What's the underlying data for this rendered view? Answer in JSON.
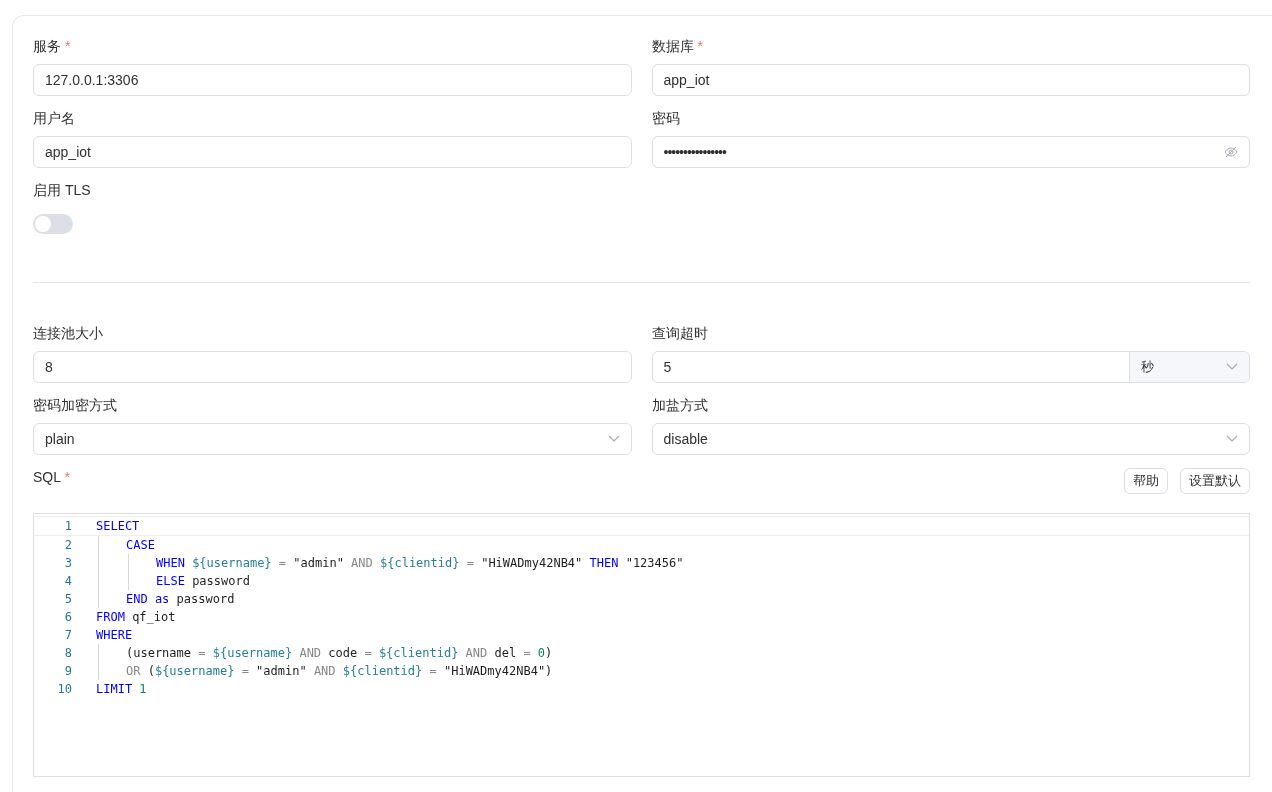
{
  "connection_fields": [
    {
      "kind": "text",
      "label": "服务",
      "required_mark": "*",
      "value": "127.0.0.1:3306"
    },
    {
      "kind": "text",
      "label": "数据库",
      "required_mark": "*",
      "value": "app_iot"
    },
    {
      "kind": "text",
      "label": "用户名",
      "value": "app_iot"
    },
    {
      "kind": "password",
      "label": "密码",
      "value": "••••••••••••••••"
    },
    {
      "kind": "toggle",
      "label": "启用 TLS",
      "on": false
    }
  ],
  "options_fields": [
    {
      "kind": "text",
      "label": "连接池大小",
      "value": "8"
    },
    {
      "kind": "unit",
      "label": "查询超时",
      "value": "5",
      "unit": "秒"
    },
    {
      "kind": "select",
      "label": "密码加密方式",
      "value": "plain"
    },
    {
      "kind": "select",
      "label": "加盐方式",
      "value": "disable"
    }
  ],
  "sql": {
    "label": "SQL",
    "required_mark": "*",
    "buttons": [
      "帮助",
      "设置默认"
    ],
    "lines": [
      {
        "number": "1",
        "tokens": [
          {
            "kind": "keyword",
            "text": "SELECT"
          }
        ],
        "children": [
          {
            "number": "2",
            "tokens": [
              {
                "kind": "keyword",
                "text": "CASE"
              }
            ],
            "children": [
              {
                "number": "3",
                "tokens": [
                  {
                    "kind": "keyword",
                    "text": "WHEN "
                  },
                  {
                    "kind": "var",
                    "text": "${username}"
                  },
                  {
                    "kind": "op",
                    "text": " = "
                  },
                  {
                    "kind": "plain",
                    "text": "\"admin\" "
                  },
                  {
                    "kind": "op",
                    "text": "AND "
                  },
                  {
                    "kind": "var",
                    "text": "${clientid}"
                  },
                  {
                    "kind": "op",
                    "text": " = "
                  },
                  {
                    "kind": "plain",
                    "text": "\"HiWADmy42NB4\" "
                  },
                  {
                    "kind": "keyword",
                    "text": "THEN "
                  },
                  {
                    "kind": "plain",
                    "text": "\"123456\""
                  }
                ]
              },
              {
                "number": "4",
                "tokens": [
                  {
                    "kind": "keyword",
                    "text": "ELSE "
                  },
                  {
                    "kind": "plain",
                    "text": "password"
                  }
                ]
              }
            ]
          },
          {
            "number": "5",
            "tokens": [
              {
                "kind": "keyword",
                "text": "END as "
              },
              {
                "kind": "plain",
                "text": "password"
              }
            ]
          }
        ]
      },
      {
        "number": "6",
        "tokens": [
          {
            "kind": "keyword",
            "text": "FROM "
          },
          {
            "kind": "plain",
            "text": "qf_iot"
          }
        ]
      },
      {
        "number": "7",
        "tokens": [
          {
            "kind": "keyword",
            "text": "WHERE"
          }
        ],
        "children": [
          {
            "number": "8",
            "tokens": [
              {
                "kind": "plain",
                "text": "(username "
              },
              {
                "kind": "op",
                "text": "= "
              },
              {
                "kind": "var",
                "text": "${username} "
              },
              {
                "kind": "op",
                "text": "AND "
              },
              {
                "kind": "plain",
                "text": "code "
              },
              {
                "kind": "op",
                "text": "= "
              },
              {
                "kind": "var",
                "text": "${clientid} "
              },
              {
                "kind": "op",
                "text": "AND "
              },
              {
                "kind": "plain",
                "text": "del "
              },
              {
                "kind": "op",
                "text": "= "
              },
              {
                "kind": "number",
                "text": "0"
              },
              {
                "kind": "plain",
                "text": ")"
              }
            ]
          },
          {
            "number": "9",
            "tokens": [
              {
                "kind": "op",
                "text": "OR "
              },
              {
                "kind": "plain",
                "text": "("
              },
              {
                "kind": "var",
                "text": "${username}"
              },
              {
                "kind": "op",
                "text": " = "
              },
              {
                "kind": "plain",
                "text": "\"admin\" "
              },
              {
                "kind": "op",
                "text": "AND "
              },
              {
                "kind": "var",
                "text": "${clientid}"
              },
              {
                "kind": "op",
                "text": " = "
              },
              {
                "kind": "plain",
                "text": "\"HiWADmy42NB4\")"
              }
            ]
          }
        ]
      },
      {
        "number": "10",
        "tokens": [
          {
            "kind": "keyword",
            "text": "LIMIT "
          },
          {
            "kind": "number",
            "text": "1"
          }
        ]
      }
    ]
  }
}
